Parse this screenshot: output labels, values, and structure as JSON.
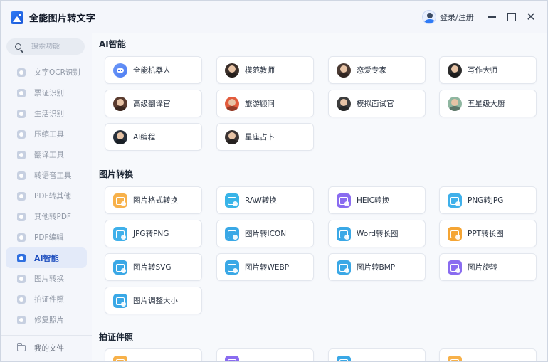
{
  "app": {
    "title": "全能图片转文字",
    "login_label": "登录/注册"
  },
  "search": {
    "placeholder": "搜索功能"
  },
  "sidebar": {
    "items": [
      {
        "label": "文字OCR识别",
        "icon": "ocr-icon",
        "active": false
      },
      {
        "label": "票证识别",
        "icon": "ticket-icon",
        "active": false
      },
      {
        "label": "生活识别",
        "icon": "leaf-icon",
        "active": false
      },
      {
        "label": "压缩工具",
        "icon": "compress-icon",
        "active": false
      },
      {
        "label": "翻译工具",
        "icon": "translate-icon",
        "active": false
      },
      {
        "label": "转语音工具",
        "icon": "audio-icon",
        "active": false
      },
      {
        "label": "PDF转其他",
        "icon": "pdf-icon",
        "active": false
      },
      {
        "label": "其他转PDF",
        "icon": "pdf-convert-icon",
        "active": false
      },
      {
        "label": "PDF编辑",
        "icon": "edit-icon",
        "active": false
      },
      {
        "label": "AI智能",
        "icon": "ai-icon",
        "active": true
      },
      {
        "label": "图片转换",
        "icon": "image-icon",
        "active": false
      },
      {
        "label": "拍证件照",
        "icon": "camera-icon",
        "active": false
      },
      {
        "label": "修复照片",
        "icon": "repair-icon",
        "active": false
      }
    ],
    "my_files_label": "我的文件"
  },
  "sections": {
    "ai": {
      "title": "AI智能",
      "items": [
        {
          "label": "全能机器人",
          "icon": "robot-icon",
          "color": "#4f7ef2"
        },
        {
          "label": "模范教师",
          "icon": "teacher-avatar-icon",
          "color": "#3a2f2a"
        },
        {
          "label": "恋爱专家",
          "icon": "love-expert-avatar-icon",
          "color": "#4a3a33"
        },
        {
          "label": "写作大师",
          "icon": "writer-avatar-icon",
          "color": "#2b2b2b"
        },
        {
          "label": "高级翻译官",
          "icon": "translator-avatar-icon",
          "color": "#5a3b2f"
        },
        {
          "label": "旅游顾问",
          "icon": "travel-avatar-icon",
          "color": "#e25b3c"
        },
        {
          "label": "模拟面试官",
          "icon": "interviewer-avatar-icon",
          "color": "#3d3d3d"
        },
        {
          "label": "五星级大厨",
          "icon": "chef-avatar-icon",
          "color": "#8fb6a0"
        },
        {
          "label": "AI编程",
          "icon": "coder-avatar-icon",
          "color": "#27303b"
        },
        {
          "label": "星座占卜",
          "icon": "astrology-avatar-icon",
          "color": "#3a3332"
        }
      ]
    },
    "image": {
      "title": "图片转换",
      "items": [
        {
          "label": "图片格式转换",
          "icon": "image-format-icon",
          "color": "#f7b14a"
        },
        {
          "label": "RAW转换",
          "icon": "raw-convert-icon",
          "color": "#38b4e8"
        },
        {
          "label": "HEIC转换",
          "icon": "heic-convert-icon",
          "color": "#8a6cf0"
        },
        {
          "label": "PNG转JPG",
          "icon": "png-to-jpg-icon",
          "color": "#3fb0ea"
        },
        {
          "label": "JPG转PNG",
          "icon": "jpg-to-png-icon",
          "color": "#3fb0ea"
        },
        {
          "label": "图片转ICON",
          "icon": "image-to-icon-icon",
          "color": "#3aa8e6"
        },
        {
          "label": "Word转长图",
          "icon": "word-to-image-icon",
          "color": "#3aa8e6"
        },
        {
          "label": "PPT转长图",
          "icon": "ppt-to-image-icon",
          "color": "#f5a534"
        },
        {
          "label": "图片转SVG",
          "icon": "image-to-svg-icon",
          "color": "#3aa8e6"
        },
        {
          "label": "图片转WEBP",
          "icon": "image-to-webp-icon",
          "color": "#3aa8e6"
        },
        {
          "label": "图片转BMP",
          "icon": "image-to-bmp-icon",
          "color": "#3aa8e6"
        },
        {
          "label": "图片旋转",
          "icon": "image-rotate-icon",
          "color": "#8a6cf0"
        },
        {
          "label": "图片调整大小",
          "icon": "image-resize-icon",
          "color": "#3aa8e6"
        }
      ]
    },
    "photo": {
      "title": "拍证件照",
      "items": [
        {
          "label": "",
          "icon": "id-photo-icon",
          "color": "#f7b14a"
        },
        {
          "label": "",
          "icon": "standard-photo-icon",
          "color": "#8a6cf0"
        },
        {
          "label": "",
          "icon": "inch-photo-icon",
          "color": "#3aa8e6"
        },
        {
          "label": "",
          "icon": "visa-photo-icon",
          "color": "#f7b14a"
        }
      ]
    }
  }
}
